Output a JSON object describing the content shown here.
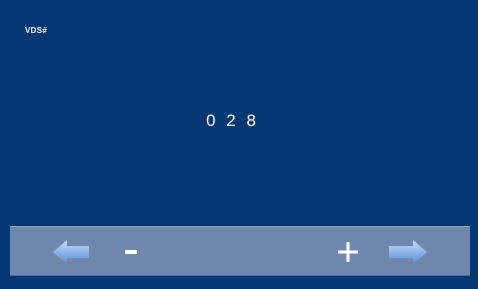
{
  "screen": {
    "title": "VDS#",
    "value": "0 2 8"
  },
  "toolbar": {
    "buttons": [
      {
        "name": "prev",
        "icon": "arrow-left-icon"
      },
      {
        "name": "decrease",
        "icon": "minus-icon"
      },
      {
        "name": "increase",
        "icon": "plus-icon"
      },
      {
        "name": "next",
        "icon": "arrow-right-icon"
      }
    ]
  },
  "colors": {
    "background": "#043773",
    "toolbar": "#6f87ad",
    "text": "#ffffff",
    "arrow": "#8fb6e8"
  }
}
